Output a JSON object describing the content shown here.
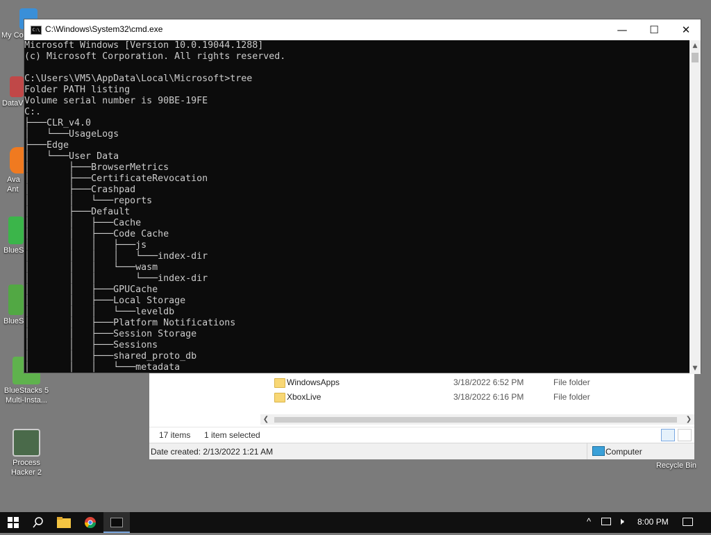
{
  "desktop": {
    "icons": [
      {
        "label": "My Co",
        "color": "#3a8fd8"
      },
      {
        "label": "DataV",
        "color": "#c04848"
      },
      {
        "label": "Ava Ant",
        "color": "#f07a20"
      },
      {
        "label": "BlueS",
        "color": "#3bb54a"
      },
      {
        "label": "BlueS",
        "color": "#52a844"
      },
      {
        "label": "BlueStacks 5 Multi-Insta...",
        "color": "#5fb24d"
      },
      {
        "label": "Process Hacker 2",
        "color": "#4a6a4a"
      },
      {
        "label": "Recycle Bin",
        "color": "#9aa0a6"
      }
    ]
  },
  "explorer": {
    "rows": [
      {
        "name": "WindowsApps",
        "date": "3/18/2022 6:52 PM",
        "type": "File folder"
      },
      {
        "name": "XboxLive",
        "date": "3/18/2022 6:16 PM",
        "type": "File folder"
      }
    ],
    "status_items": "17 items",
    "status_selected": "1 item selected",
    "date_created": "Date created: 2/13/2022 1:21 AM",
    "location": "Computer"
  },
  "cmd": {
    "title": "C:\\Windows\\System32\\cmd.exe",
    "icon_text": "C:\\",
    "buttons": {
      "minimize": "—",
      "maximize": "☐",
      "close": "✕"
    },
    "lines": [
      "Microsoft Windows [Version 10.0.19044.1288]",
      "(c) Microsoft Corporation. All rights reserved.",
      "",
      "C:\\Users\\VM5\\AppData\\Local\\Microsoft>tree",
      "Folder PATH listing",
      "Volume serial number is 90BE-19FE",
      "C:.",
      "├───CLR_v4.0",
      "│   └───UsageLogs",
      "├───Edge",
      "│   └───User Data",
      "│       ├───BrowserMetrics",
      "│       ├───CertificateRevocation",
      "│       ├───Crashpad",
      "│       │   └───reports",
      "│       ├───Default",
      "│       │   ├───Cache",
      "│       │   ├───Code Cache",
      "│       │   │   ├───js",
      "│       │   │   │   └───index-dir",
      "│       │   │   └───wasm",
      "│       │   │       └───index-dir",
      "│       │   ├───GPUCache",
      "│       │   ├───Local Storage",
      "│       │   │   └───leveldb",
      "│       │   ├───Platform Notifications",
      "│       │   ├───Session Storage",
      "│       │   ├───Sessions",
      "│       │   ├───shared_proto_db",
      "│       │   │   └───metadata"
    ]
  },
  "taskbar": {
    "start_icon": "windows-logo",
    "search_icon": "search",
    "apps": [
      "file-explorer",
      "chrome",
      "cmd"
    ],
    "tray": {
      "chevron": "^",
      "time": "8:00 PM"
    }
  }
}
